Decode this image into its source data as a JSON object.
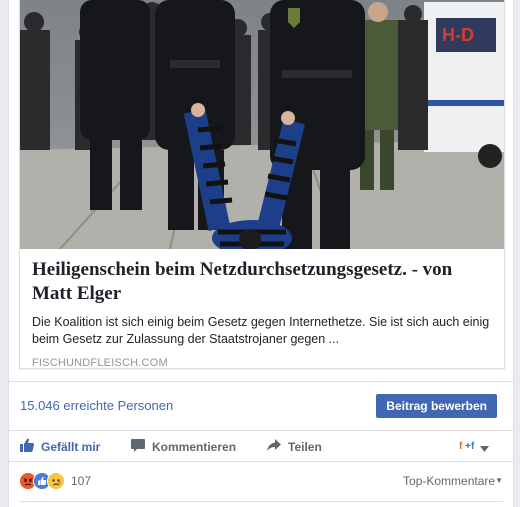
{
  "link_preview": {
    "headline": "Heiligenschein beim Netzdurchsetzungsgesetz. - von Matt Elger",
    "description": "Die Koalition ist sich einig beim Gesetz gegen Internethetze. Sie ist sich auch einig beim Gesetz zur Zulassung der Staatstrojaner gegen ...",
    "domain": "FISCHUNDFLEISCH.COM",
    "image_text": "H-D"
  },
  "reach": {
    "text": "15.046 erreichte Personen",
    "boost_label": "Beitrag bewerben"
  },
  "actions": {
    "like": "Gefällt mir",
    "comment": "Kommentieren",
    "share": "Teilen"
  },
  "reactions": {
    "count": "107",
    "icons": [
      "angry-icon",
      "like-icon",
      "sad-icon"
    ],
    "sort_label": "Top-Kommentare"
  },
  "colors": {
    "link_blue": "#4267b2",
    "text_gray": "#606770",
    "border": "#dddfe2"
  }
}
